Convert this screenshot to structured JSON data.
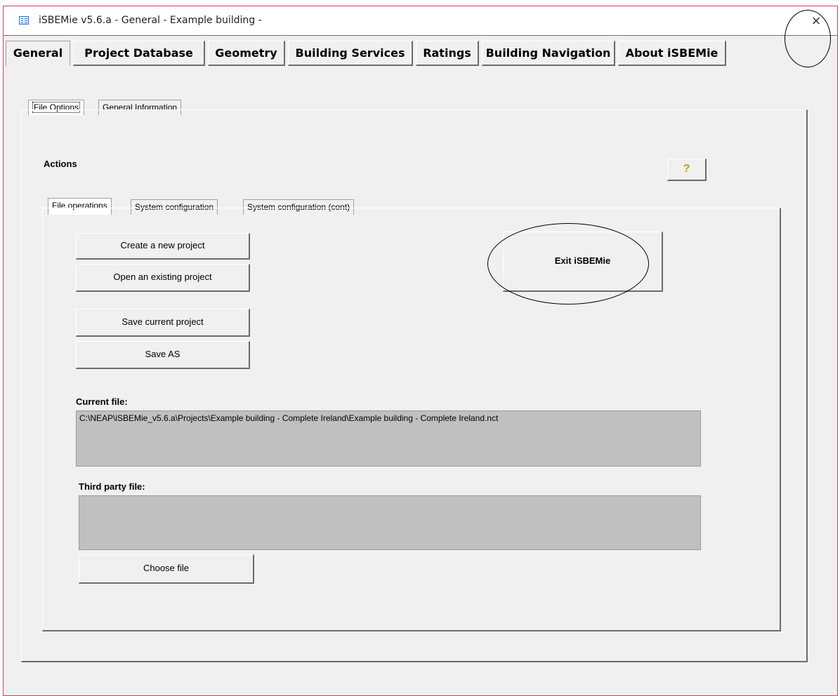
{
  "window": {
    "title": "iSBEMie v5.6.a - General - Example building -",
    "close_glyph": "×",
    "icon": "form-icon"
  },
  "main_tabs": [
    {
      "label": "General",
      "active": true
    },
    {
      "label": "Project Database"
    },
    {
      "label": "Geometry"
    },
    {
      "label": "Building Services"
    },
    {
      "label": "Ratings"
    },
    {
      "label": "Building Navigation"
    },
    {
      "label": "About iSBEMie"
    }
  ],
  "sub_tabs": [
    {
      "label": "File Options",
      "active": true
    },
    {
      "label": "General Information"
    }
  ],
  "actions": {
    "label": "Actions",
    "help_icon": "help-icon",
    "help_glyph": "?",
    "tabs": [
      {
        "label": "File operations",
        "active": true
      },
      {
        "label": "System configuration"
      },
      {
        "label": "System configuration (cont)"
      }
    ]
  },
  "file_operations": {
    "create": "Create a new project",
    "open": "Open an existing project",
    "save": "Save current project",
    "save_as": "Save AS",
    "exit": "Exit iSBEMie",
    "current_file_label": "Current file:",
    "current_file_value": "C:\\NEAP\\iSBEMie_v5.6.a\\Projects\\Example building - Complete Ireland\\Example building - Complete Ireland.nct",
    "third_party_label": "Third party file:",
    "third_party_value": "",
    "choose_file": "Choose file"
  },
  "colors": {
    "window_border": "#c94a5a",
    "face": "#f0f0f0",
    "field_bg": "#c0c0c0",
    "help_icon": "#c8a000"
  }
}
